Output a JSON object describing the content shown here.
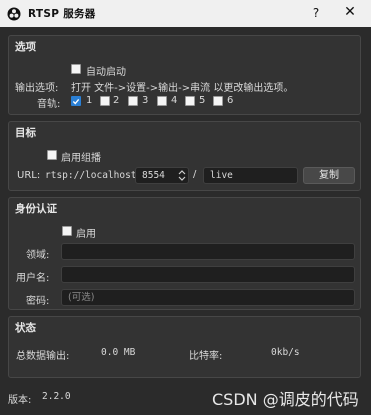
{
  "window": {
    "title": "RTSP 服务器",
    "help_label": "?",
    "close_label": "✕",
    "icon": "obs-logo-icon"
  },
  "options": {
    "title": "选项",
    "auto_start_label": "自动启动",
    "auto_start_checked": false,
    "output_label": "输出选项:",
    "output_hint": "打开 文件->设置->输出->串流 以更改输出选项。",
    "tracks_label": "音轨:",
    "tracks": [
      {
        "label": "1",
        "checked": true
      },
      {
        "label": "2",
        "checked": false
      },
      {
        "label": "3",
        "checked": false
      },
      {
        "label": "4",
        "checked": false
      },
      {
        "label": "5",
        "checked": false
      },
      {
        "label": "6",
        "checked": false
      }
    ]
  },
  "target": {
    "title": "目标",
    "multicast_label": "启用组播",
    "multicast_checked": false,
    "url_label": "URL:",
    "url_prefix": "rtsp://localhost:",
    "port": "8554",
    "separator": "/",
    "path": "live",
    "copy_label": "复制"
  },
  "auth": {
    "title": "身份认证",
    "enable_label": "启用",
    "enable_checked": false,
    "realm_label": "领域:",
    "realm_value": "",
    "username_label": "用户名:",
    "username_value": "",
    "password_label": "密码:",
    "password_placeholder": "(可选)"
  },
  "status": {
    "title": "状态",
    "total_output_label": "总数据输出:",
    "total_output_value": "0.0 MB",
    "bitrate_label": "比特率:",
    "bitrate_value": "0kb/s"
  },
  "footer": {
    "version_label": "版本:",
    "version_value": "2.2.0",
    "watermark": "CSDN @调皮的代码"
  },
  "colors": {
    "background": "#2b2b2b",
    "group": "#333333",
    "accent": "#2a7fd4",
    "titlebar": "#f0f0f0"
  }
}
